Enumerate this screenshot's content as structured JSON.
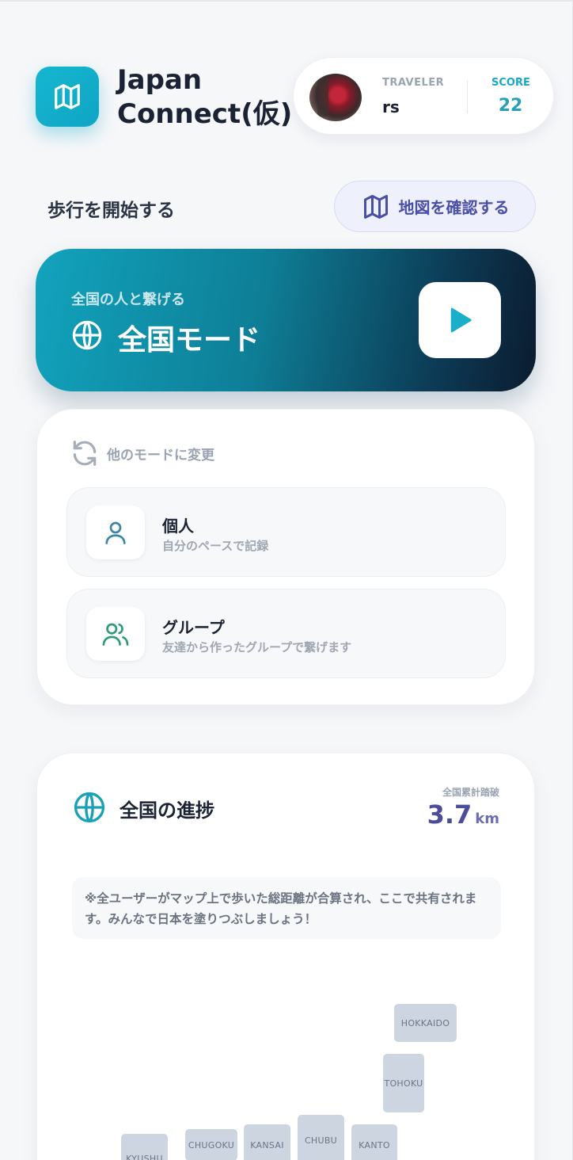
{
  "header": {
    "app_title": "Japan Connect(仮)",
    "user": {
      "traveler_label": "TRAVELER",
      "traveler_name": "rs",
      "score_label": "SCORE",
      "score_value": "22"
    }
  },
  "start_section": {
    "title": "歩行を開始する",
    "map_button_label": "地図を確認する"
  },
  "nationwide_mode": {
    "subtitle": "全国の人と繋げる",
    "title": "全国モード"
  },
  "other_modes": {
    "header": "他のモードに変更",
    "items": [
      {
        "title": "個人",
        "description": "自分のペースで記録",
        "icon": "person-icon"
      },
      {
        "title": "グループ",
        "description": "友達から作ったグループで繋げます",
        "icon": "group-icon"
      }
    ]
  },
  "progress": {
    "title": "全国の進捗",
    "total_label": "全国累計踏破",
    "total_value": "3.7",
    "total_unit": "km",
    "notice": "※全ユーザーがマップ上で歩いた総距離が合算され、ここで共有されます。みんなで日本を塗りつぶしましょう！",
    "regions": [
      "HOKKAIDO",
      "TOHOKU",
      "KANTO",
      "CHUBU",
      "KANSAI",
      "CHUGOKU",
      "KYUSHU"
    ]
  },
  "colors": {
    "accent_cyan": "#16b7d0",
    "accent_indigo": "#4b4c9c",
    "region_fill": "#cdd5e1"
  }
}
